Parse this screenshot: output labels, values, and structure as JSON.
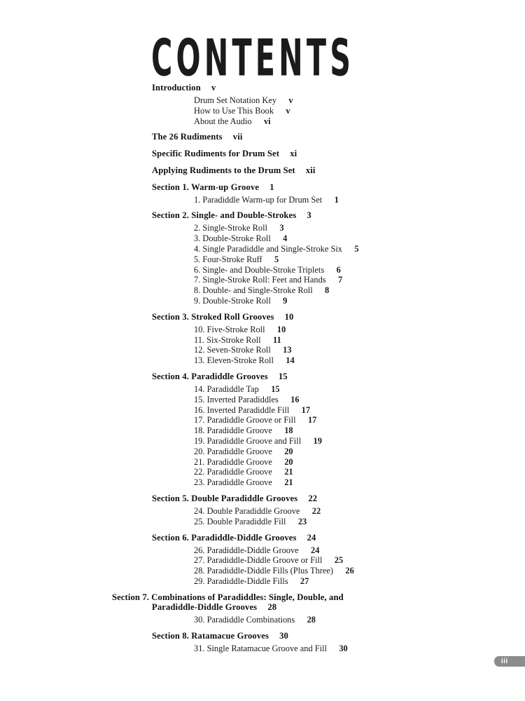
{
  "document": {
    "title": "CONTENTS",
    "folio": "iii"
  },
  "toc": {
    "entries": [
      {
        "level": 1,
        "text": "Introduction",
        "page": "v",
        "first": true
      },
      {
        "level": 2,
        "text": "Drum Set Notation Key",
        "page": "v",
        "block_start": true
      },
      {
        "level": 2,
        "text": "How to Use This Book",
        "page": "v"
      },
      {
        "level": 2,
        "text": "About the Audio",
        "page": "vi"
      },
      {
        "level": 1,
        "text": "The 26 Rudiments",
        "page": "vii"
      },
      {
        "level": 1,
        "text": "Specific Rudiments for Drum Set",
        "page": "xi"
      },
      {
        "level": 1,
        "text": "Applying Rudiments to the Drum Set",
        "page": "xii"
      },
      {
        "level": 1,
        "text": "Section 1. Warm-up Groove",
        "page": "1"
      },
      {
        "level": 2,
        "text": "1. Paradiddle Warm-up for Drum Set",
        "page": "1",
        "block_start": true
      },
      {
        "level": 1,
        "text": "Section 2. Single- and Double-Strokes",
        "page": "3"
      },
      {
        "level": 2,
        "text": "2. Single-Stroke Roll",
        "page": "3",
        "block_start": true
      },
      {
        "level": 2,
        "text": "3. Double-Stroke Roll",
        "page": "4"
      },
      {
        "level": 2,
        "text": "4. Single Paradiddle and Single-Stroke Six",
        "page": "5"
      },
      {
        "level": 2,
        "text": "5. Four-Stroke Ruff",
        "page": "5"
      },
      {
        "level": 2,
        "text": "6. Single- and Double-Stroke Triplets",
        "page": "6"
      },
      {
        "level": 2,
        "text": "7. Single-Stroke Roll: Feet and Hands",
        "page": "7"
      },
      {
        "level": 2,
        "text": "8. Double- and Single-Stroke Roll",
        "page": "8"
      },
      {
        "level": 2,
        "text": "9. Double-Stroke Roll",
        "page": "9"
      },
      {
        "level": 1,
        "text": "Section 3. Stroked Roll Grooves",
        "page": "10"
      },
      {
        "level": 2,
        "text": "10. Five-Stroke Roll",
        "page": "10",
        "block_start": true
      },
      {
        "level": 2,
        "text": "11. Six-Stroke Roll",
        "page": "11"
      },
      {
        "level": 2,
        "text": "12. Seven-Stroke Roll",
        "page": "13"
      },
      {
        "level": 2,
        "text": "13. Eleven-Stroke Roll",
        "page": "14"
      },
      {
        "level": 1,
        "text": "Section 4. Paradiddle Grooves",
        "page": "15"
      },
      {
        "level": 2,
        "text": "14. Paradiddle Tap",
        "page": "15",
        "block_start": true
      },
      {
        "level": 2,
        "text": "15. Inverted Paradiddles",
        "page": "16"
      },
      {
        "level": 2,
        "text": "16. Inverted Paradiddle Fill",
        "page": "17"
      },
      {
        "level": 2,
        "text": "17. Paradiddle Groove or Fill",
        "page": "17"
      },
      {
        "level": 2,
        "text": "18. Paradiddle Groove",
        "page": "18"
      },
      {
        "level": 2,
        "text": "19. Paradiddle Groove and Fill",
        "page": "19"
      },
      {
        "level": 2,
        "text": "20. Paradiddle Groove",
        "page": "20"
      },
      {
        "level": 2,
        "text": "21. Paradiddle Groove",
        "page": "20"
      },
      {
        "level": 2,
        "text": "22. Paradiddle Groove",
        "page": "21"
      },
      {
        "level": 2,
        "text": "23. Paradiddle Groove",
        "page": "21"
      },
      {
        "level": 1,
        "text": "Section 5. Double Paradiddle Grooves",
        "page": "22"
      },
      {
        "level": 2,
        "text": "24. Double Paradiddle Groove",
        "page": "22",
        "block_start": true
      },
      {
        "level": 2,
        "text": "25. Double Paradiddle Fill",
        "page": "23"
      },
      {
        "level": 1,
        "text": "Section 6. Paradiddle-Diddle Grooves",
        "page": "24"
      },
      {
        "level": 2,
        "text": "26. Paradiddle-Diddle Groove",
        "page": "24",
        "block_start": true
      },
      {
        "level": 2,
        "text": "27. Paradiddle-Diddle Groove or Fill",
        "page": "25"
      },
      {
        "level": 2,
        "text": "28. Paradiddle-Diddle Fills (Plus Three)",
        "page": "26"
      },
      {
        "level": 2,
        "text": "29. Paradiddle-Diddle Fills",
        "page": "27"
      },
      {
        "level": 1,
        "wrap": true,
        "text": "Section 7. Combinations of Paradiddles: Single, Double, and Paradiddle-Diddle Grooves",
        "page": "28"
      },
      {
        "level": 2,
        "text": "30. Paradiddle Combinations",
        "page": "28",
        "block_start": true
      },
      {
        "level": 1,
        "text": "Section 8. Ratamacue Grooves",
        "page": "30"
      },
      {
        "level": 2,
        "text": "31. Single Ratamacue Groove and Fill",
        "page": "30",
        "block_start": true
      }
    ]
  }
}
